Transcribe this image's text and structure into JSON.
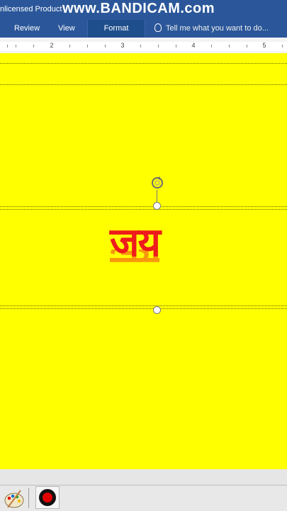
{
  "titlebar": {
    "title": "nlicensed Product",
    "watermark": "www.BANDICAM.com"
  },
  "ribbon": {
    "tabs": [
      {
        "label": "Review"
      },
      {
        "label": "View"
      },
      {
        "label": "Format",
        "active": true
      }
    ],
    "tell_me": "Tell me what you want to do..."
  },
  "ruler": {
    "numbers": [
      "2",
      "3",
      "4",
      "5"
    ]
  },
  "document": {
    "wordart_text": "जय"
  },
  "colors": {
    "page_background": "#ffff00",
    "wordart": "#ee1c1c",
    "ribbon": "#2b579a"
  },
  "taskbar": {
    "icons": [
      "paint-palette-icon",
      "record-icon"
    ]
  }
}
